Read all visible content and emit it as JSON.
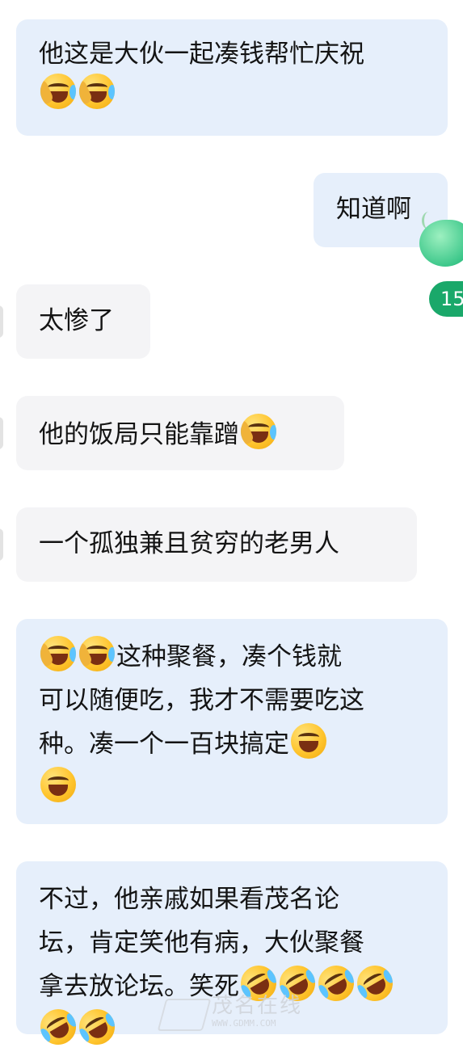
{
  "messages": [
    {
      "id": "m1",
      "side": "left",
      "text_lines": [
        "他这是大伙一起凑钱帮忙庆祝"
      ],
      "emoji_tail": [
        "face-with-tears-of-joy",
        "face-with-tears-of-joy"
      ]
    },
    {
      "id": "m2",
      "side": "right",
      "text": "知道啊"
    },
    {
      "id": "m3",
      "side": "left",
      "text": "太惨了"
    },
    {
      "id": "m4",
      "side": "left",
      "text": "他的饭局只能靠蹭"
    },
    {
      "id": "m5",
      "side": "left",
      "text": "一个孤独兼且贫穷的老男人"
    },
    {
      "id": "m6",
      "side": "left",
      "line1": "这种聚餐，凑个钱就",
      "line2": "可以随便吃，我才不需要吃这",
      "line3": "种。凑一个一百块搞定"
    },
    {
      "id": "m7",
      "side": "left",
      "line1": "不过，他亲戚如果看茂名论",
      "line2": "坛，肯定笑他有病，大伙聚餐",
      "line3": "拿去放论坛。笑死"
    }
  ],
  "side_badge": "15",
  "watermark": {
    "text": "茂名在线",
    "url": "WWW.GDMM.COM"
  },
  "colors": {
    "bubble_blue": "#e6effb",
    "bubble_grey": "#f4f4f6",
    "badge_green": "#1aa86a"
  }
}
